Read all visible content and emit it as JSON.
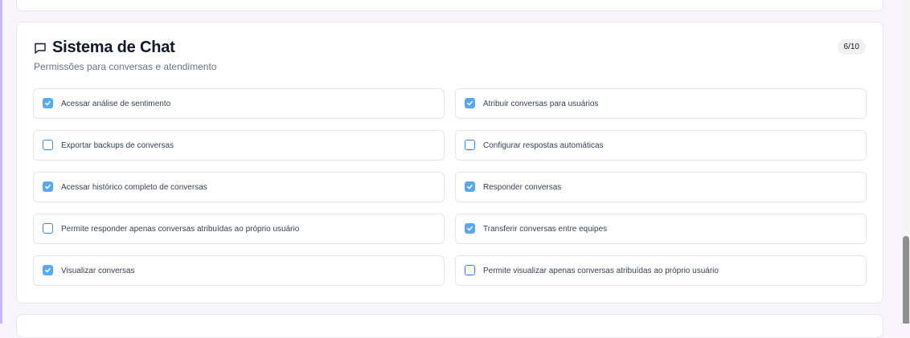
{
  "section": {
    "title": "Sistema de Chat",
    "subtitle": "Permissões para conversas e atendimento",
    "count": "6/10",
    "icon": "chat-bubble-icon"
  },
  "permissions": [
    {
      "label": "Acessar análise de sentimento",
      "checked": true
    },
    {
      "label": "Atribuir conversas para usuários",
      "checked": true
    },
    {
      "label": "Exportar backups de conversas",
      "checked": false
    },
    {
      "label": "Configurar respostas automáticas",
      "checked": false
    },
    {
      "label": "Acessar histórico completo de conversas",
      "checked": true
    },
    {
      "label": "Responder conversas",
      "checked": true
    },
    {
      "label": "Permite responder apenas conversas atribuídas ao próprio usuário",
      "checked": false
    },
    {
      "label": "Transferir conversas entre equipes",
      "checked": true
    },
    {
      "label": "Visualizar conversas",
      "checked": true
    },
    {
      "label": "Permite visualizar apenas conversas atribuídas ao próprio usuário",
      "checked": false
    }
  ],
  "colors": {
    "checkbox_checked": "#5aa9f0",
    "checkbox_border": "#3b82f6",
    "page_background": "#f8f5fe"
  }
}
